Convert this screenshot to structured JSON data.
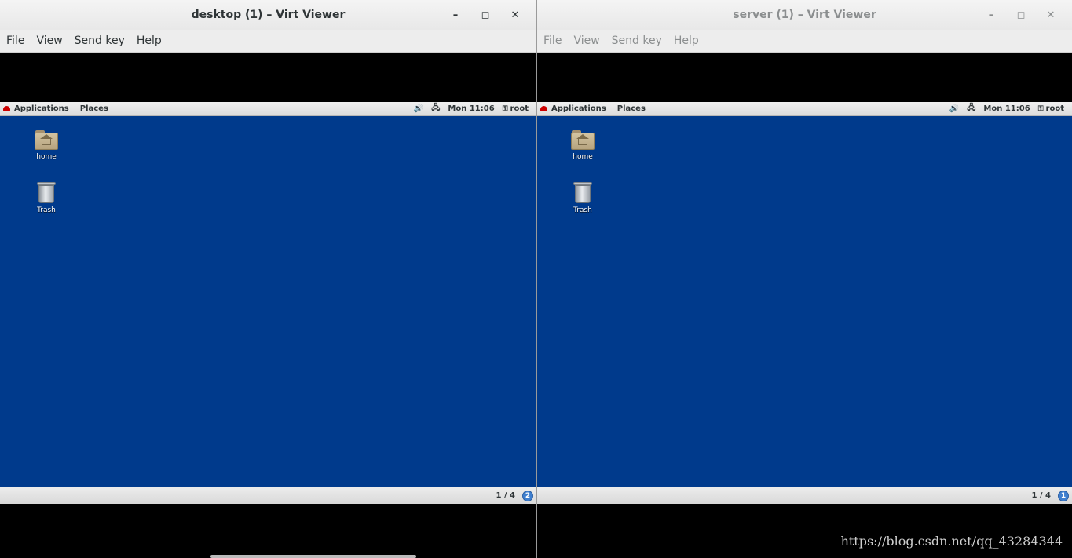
{
  "windows": [
    {
      "title": "desktop (1) – Virt Viewer",
      "active": true,
      "controls": {
        "minimize": "–",
        "maximize": "◻",
        "close": "✕"
      },
      "menu": [
        "File",
        "View",
        "Send key",
        "Help"
      ],
      "panel": {
        "applications": "Applications",
        "places": "Places",
        "volume_icon": "🔊",
        "display_icon": "🖧",
        "clock": "Mon 11:06",
        "key_icon": "⚿",
        "user": "root"
      },
      "desktop_icons": [
        {
          "label": "home",
          "icon": "home-folder-icon"
        },
        {
          "label": "Trash",
          "icon": "trash-icon"
        }
      ],
      "workspace": "1 / 4",
      "notification_count": "2"
    },
    {
      "title": "server (1) – Virt Viewer",
      "active": false,
      "controls": {
        "minimize": "–",
        "maximize": "◻",
        "close": "✕"
      },
      "menu": [
        "File",
        "View",
        "Send key",
        "Help"
      ],
      "panel": {
        "applications": "Applications",
        "places": "Places",
        "volume_icon": "🔊",
        "display_icon": "🖧",
        "clock": "Mon 11:06",
        "key_icon": "⚿",
        "user": "root"
      },
      "desktop_icons": [
        {
          "label": "home",
          "icon": "home-folder-icon"
        },
        {
          "label": "Trash",
          "icon": "trash-icon"
        }
      ],
      "workspace": "1 / 4",
      "notification_count": "1"
    }
  ],
  "watermark": "https://blog.csdn.net/qq_43284344",
  "colors": {
    "desktop_background": "#003a8c",
    "titlebar": "#efefef",
    "notification": "#3f7fcf"
  }
}
